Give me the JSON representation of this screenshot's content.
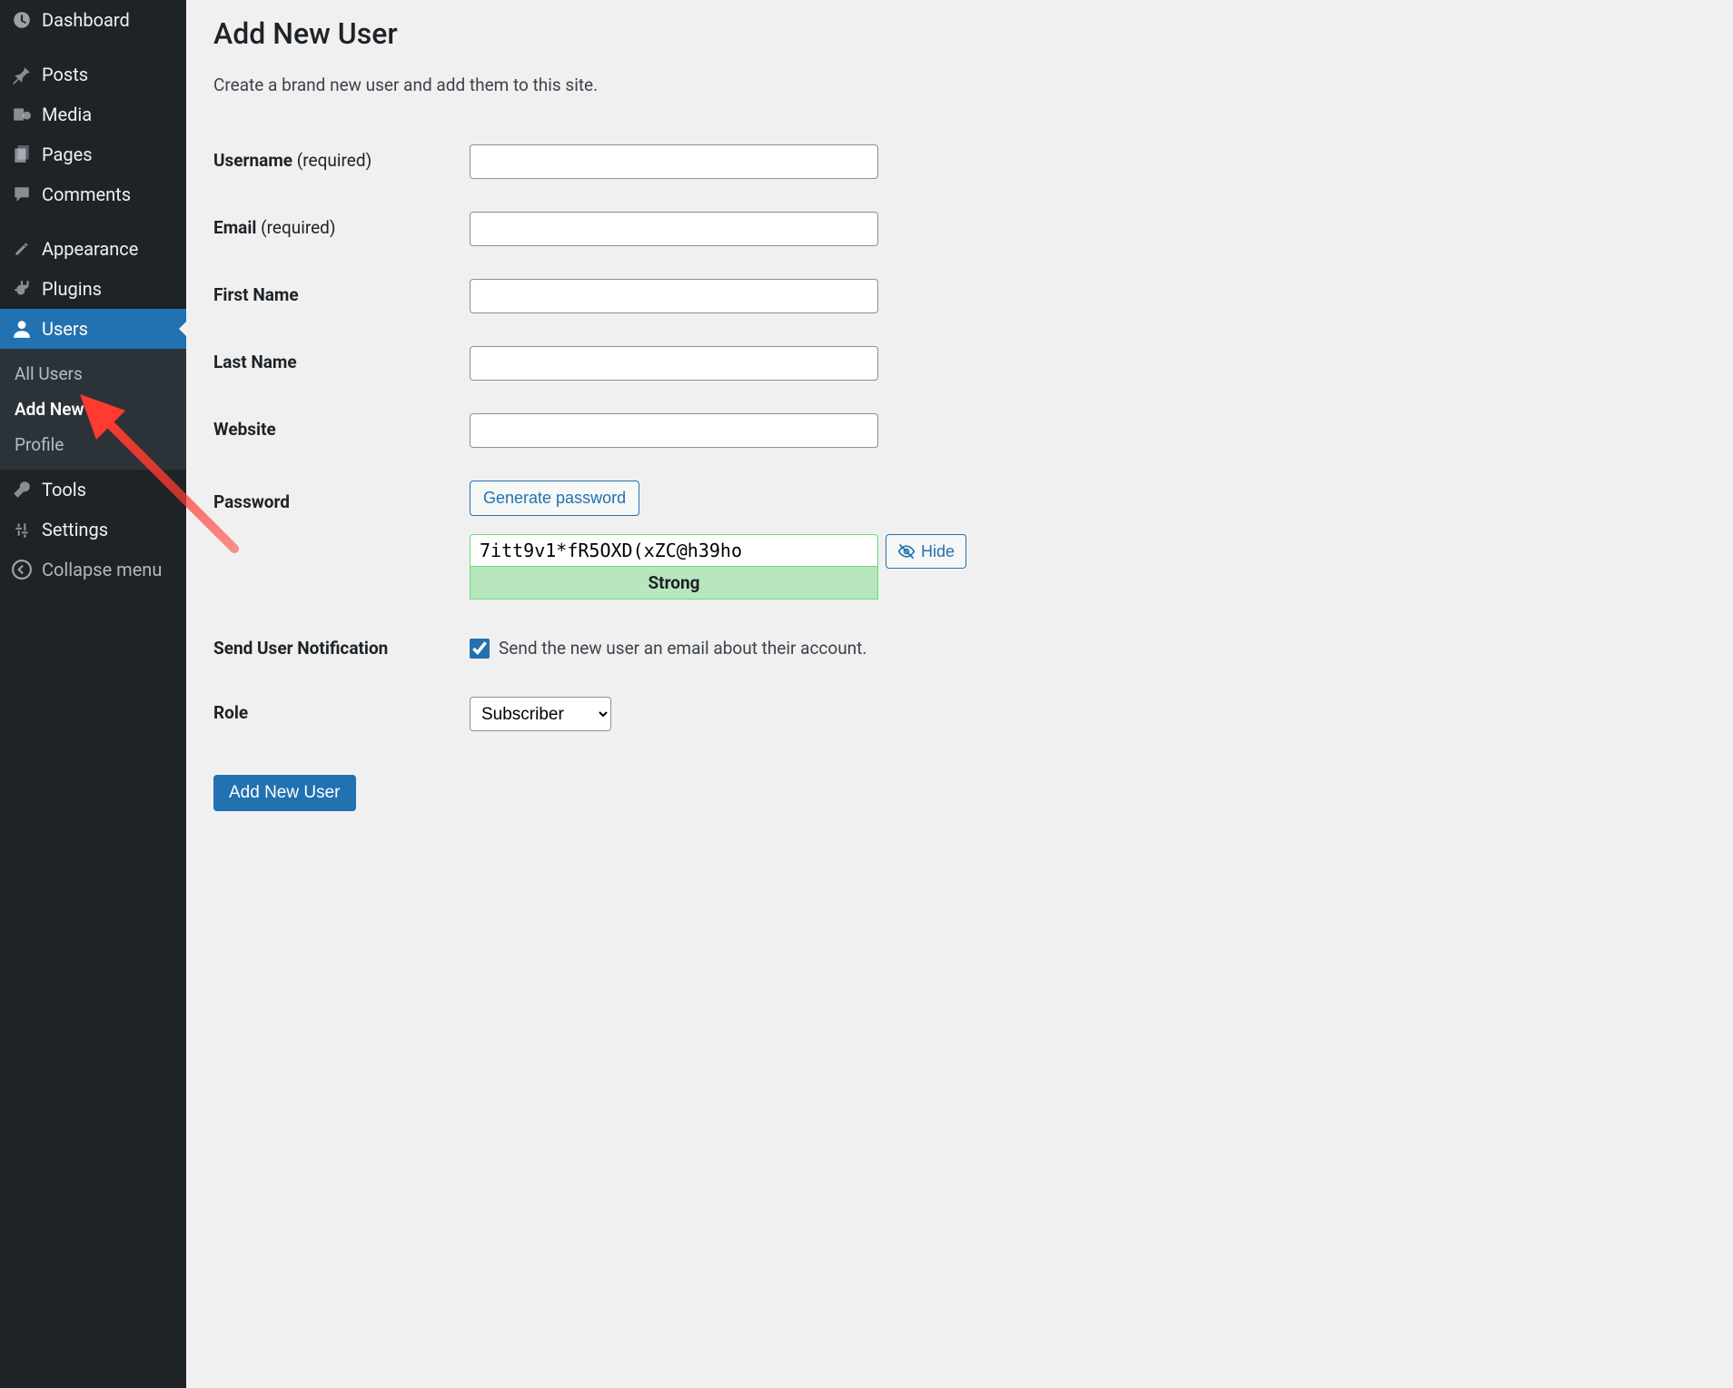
{
  "sidebar": {
    "items": [
      {
        "label": "Dashboard",
        "icon": "dashboard-icon"
      },
      {
        "label": "Posts",
        "icon": "pin-icon"
      },
      {
        "label": "Media",
        "icon": "media-icon"
      },
      {
        "label": "Pages",
        "icon": "pages-icon"
      },
      {
        "label": "Comments",
        "icon": "comments-icon"
      },
      {
        "label": "Appearance",
        "icon": "appearance-icon"
      },
      {
        "label": "Plugins",
        "icon": "plugins-icon"
      },
      {
        "label": "Users",
        "icon": "users-icon"
      },
      {
        "label": "Tools",
        "icon": "tools-icon"
      },
      {
        "label": "Settings",
        "icon": "settings-icon"
      }
    ],
    "submenu": {
      "items": [
        {
          "label": "All Users"
        },
        {
          "label": "Add New"
        },
        {
          "label": "Profile"
        }
      ]
    },
    "collapse": "Collapse menu"
  },
  "page": {
    "title": "Add New User",
    "description": "Create a brand new user and add them to this site."
  },
  "form": {
    "username_label": "Username",
    "username_required": "(required)",
    "username_value": "",
    "email_label": "Email",
    "email_required": "(required)",
    "email_value": "",
    "first_name_label": "First Name",
    "first_name_value": "",
    "last_name_label": "Last Name",
    "last_name_value": "",
    "website_label": "Website",
    "website_value": "",
    "password_label": "Password",
    "generate_button": "Generate password",
    "password_value": "7itt9v1*fR5OXD(xZC@h39ho",
    "strength_text": "Strong",
    "hide_button": "Hide",
    "notification_label": "Send User Notification",
    "notification_checkbox_label": "Send the new user an email about their account.",
    "notification_checked": true,
    "role_label": "Role",
    "role_value": "Subscriber",
    "submit_button": "Add New User"
  },
  "colors": {
    "accent": "#2271b1",
    "sidebar_bg": "#1d2327",
    "content_bg": "#f0f0f1",
    "strength_bg": "#b8e6bf",
    "arrow": "#ff3b30"
  }
}
